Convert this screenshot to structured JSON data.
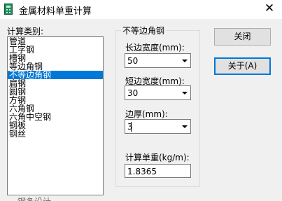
{
  "window": {
    "title": "金属材料单重计算",
    "close_glyph": "✕"
  },
  "calc_type": {
    "label": "计算类别:",
    "items": [
      "管道",
      "工字钢",
      "槽钢",
      "等边角钢",
      "不等边角钢",
      "扁钢",
      "圆钢",
      "方钢",
      "六角钢",
      "六角中空钢",
      "钢板",
      "钢丝"
    ],
    "selected": "不等边角钢"
  },
  "group": {
    "title": "不等边角钢",
    "long_edge": {
      "label": "长边宽度(mm):",
      "value": "50"
    },
    "short_edge": {
      "label": "短边宽度(mm):",
      "value": "30"
    },
    "thickness": {
      "label": "边厚(mm):",
      "value": "3"
    },
    "unit_weight": {
      "label": "计算单重(kg/m):",
      "value": "1.8365"
    }
  },
  "buttons": {
    "close": "关闭",
    "about": "关于(A)"
  },
  "cutoff_text": "钢条设计"
}
